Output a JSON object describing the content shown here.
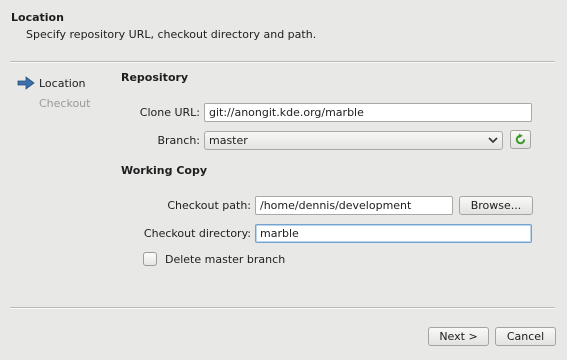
{
  "header": {
    "title": "Location",
    "subtitle": "Specify repository URL, checkout directory and path."
  },
  "nav": {
    "items": [
      {
        "label": "Location",
        "state": "current",
        "icon": "arrow-right-icon"
      },
      {
        "label": "Checkout",
        "state": "disabled"
      }
    ]
  },
  "repository": {
    "heading": "Repository",
    "clone_url_label": "Clone URL:",
    "clone_url_value": "git://anongit.kde.org/marble",
    "branch_label": "Branch:",
    "branch_value": "master",
    "refresh_icon": "refresh-icon"
  },
  "working_copy": {
    "heading": "Working Copy",
    "checkout_path_label": "Checkout path:",
    "checkout_path_value": "/home/dennis/development",
    "browse_label": "Browse...",
    "checkout_dir_label": "Checkout directory:",
    "checkout_dir_value": "marble",
    "delete_branch_label": "Delete master branch",
    "delete_branch_checked": false
  },
  "footer": {
    "next_label": "Next >",
    "cancel_label": "Cancel"
  },
  "colors": {
    "background": "#e8e8e7",
    "focus": "#75a3cf",
    "nav_arrow": "#3d6fa8",
    "refresh": "#3f9a2c"
  }
}
